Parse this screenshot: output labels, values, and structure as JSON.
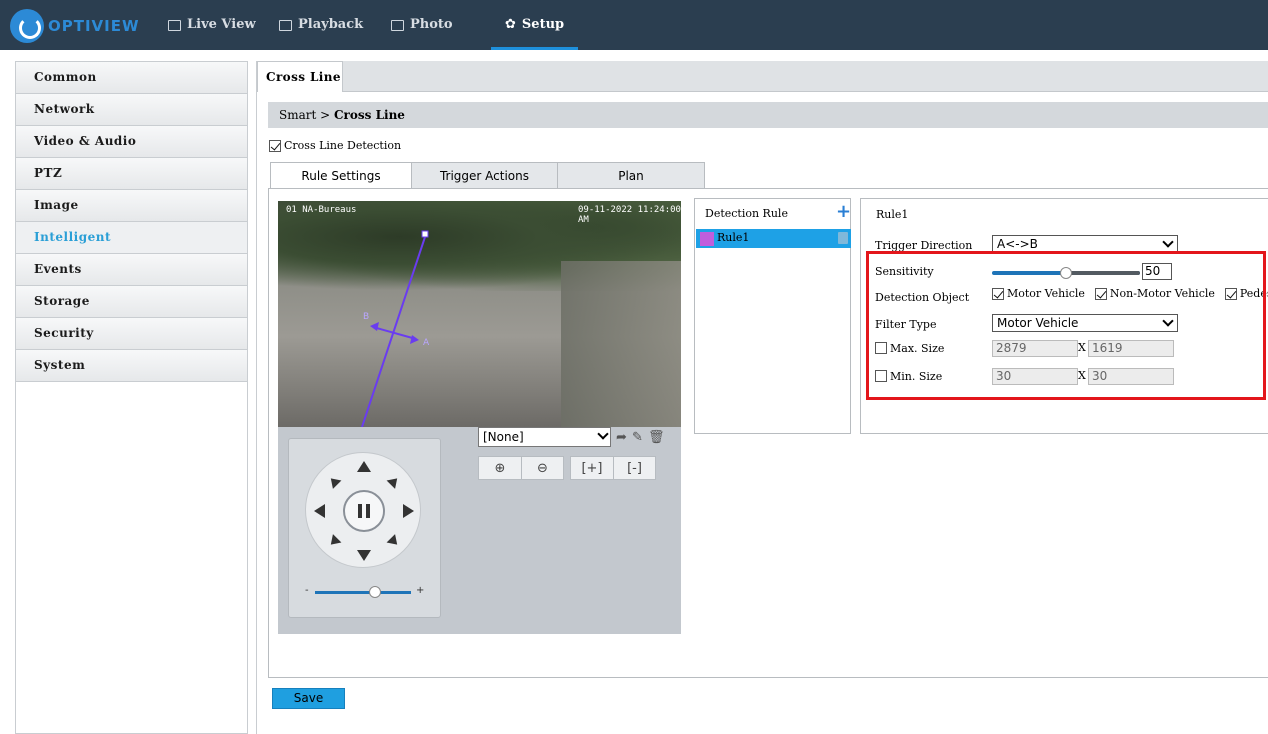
{
  "app": {
    "brand": "OPTIVIEW"
  },
  "nav": [
    {
      "label": "Live View",
      "icon": "monitor-icon"
    },
    {
      "label": "Playback",
      "icon": "film-icon"
    },
    {
      "label": "Photo",
      "icon": "image-icon"
    },
    {
      "label": "Setup",
      "icon": "gear-icon",
      "active": true
    }
  ],
  "sidebar": {
    "items": [
      {
        "label": "Common"
      },
      {
        "label": "Network"
      },
      {
        "label": "Video & Audio"
      },
      {
        "label": "PTZ"
      },
      {
        "label": "Image"
      },
      {
        "label": "Intelligent",
        "active": true
      },
      {
        "label": "Events"
      },
      {
        "label": "Storage"
      },
      {
        "label": "Security"
      },
      {
        "label": "System"
      }
    ]
  },
  "page": {
    "tab": "Cross Line",
    "breadcrumb_parent": "Smart",
    "breadcrumb_sep": " > ",
    "breadcrumb_current": "Cross Line",
    "enable_label": "Cross Line Detection",
    "enable_checked": true,
    "sub_tabs": [
      "Rule Settings",
      "Trigger Actions",
      "Plan"
    ],
    "active_sub_tab": "Rule Settings"
  },
  "video": {
    "osd_left": "01  NA-Bureaus",
    "osd_right": "09-11-2022  11:24:00 AM",
    "line_label_a": "A",
    "line_label_b": "B"
  },
  "ptz": {
    "preset_value": "[None]",
    "speed_minus": "-",
    "speed_plus": "+",
    "speed_level": 0.62,
    "zoom_in": "⊕",
    "zoom_out": "⊖",
    "focus_near": "[+]",
    "focus_far": "[-]"
  },
  "detection_rule": {
    "header": "Detection Rule",
    "add_symbol": "+",
    "rules": [
      {
        "name": "Rule1",
        "color": "#c15edc"
      }
    ]
  },
  "rule": {
    "title": "Rule1",
    "trigger_direction_label": "Trigger Direction",
    "trigger_direction_value": "A<->B",
    "sensitivity_label": "Sensitivity",
    "sensitivity_value": "50",
    "sensitivity_fraction": 0.5,
    "detection_object_label": "Detection Object",
    "objects": [
      {
        "label": "Motor Vehicle",
        "checked": true
      },
      {
        "label": "Non-Motor Vehicle",
        "checked": true
      },
      {
        "label": "Pedestrian",
        "checked": true
      }
    ],
    "filter_type_label": "Filter Type",
    "filter_type_value": "Motor Vehicle",
    "max_size_label": "Max. Size",
    "max_w": "2879",
    "max_h": "1619",
    "min_size_label": "Min. Size",
    "min_w": "30",
    "min_h": "30",
    "x_sep": "X"
  },
  "actions": {
    "save_label": "Save"
  },
  "colors": {
    "accent": "#1f9fe0",
    "topbar": "#2b3e50",
    "highlight": "#e3161b",
    "line": "#6a3cf0"
  }
}
